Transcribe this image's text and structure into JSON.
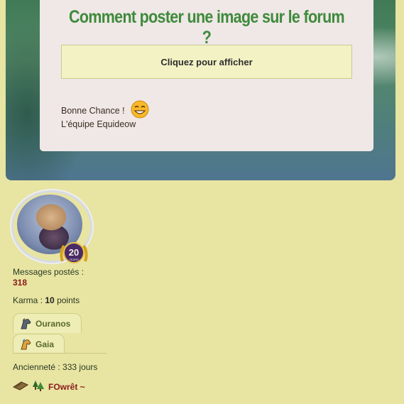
{
  "card": {
    "title": "Comment poster une image sur le forum ?",
    "spoiler_label": "Cliquez pour afficher",
    "line1": "Bonne Chance !",
    "line2": "L'équipe Equideow"
  },
  "profile": {
    "messages_label": "Messages postés :",
    "messages_value": "318",
    "karma_label": "Karma :",
    "karma_value": "10",
    "karma_unit": "points",
    "tabs": [
      {
        "label": "Ouranos",
        "icon": "horse-head-icon"
      },
      {
        "label": "Gaia",
        "icon": "horse-head-icon"
      }
    ],
    "seniority": "Ancienneté : 333 jours",
    "forest_name": "FOwrêt ~",
    "badge_text": "20",
    "badge_sub": "YEARS"
  },
  "colors": {
    "title_green": "#3f8a3c",
    "page_bg": "#e8e4a2",
    "value_red": "#8a1a1a"
  }
}
